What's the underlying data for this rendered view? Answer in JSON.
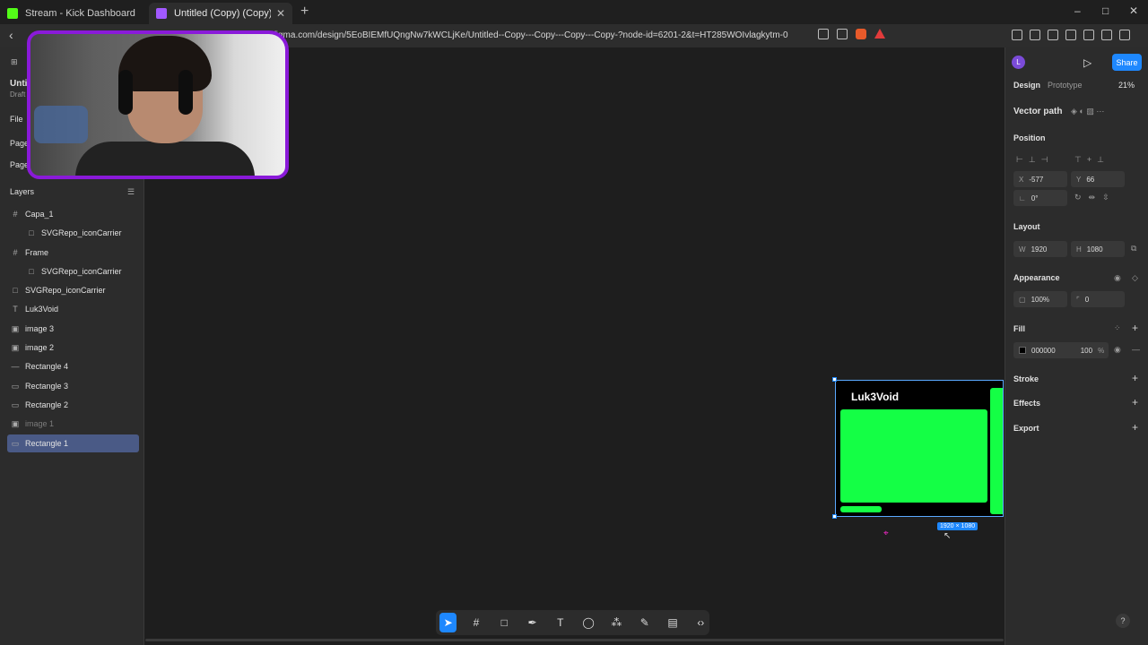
{
  "browser": {
    "tabs": [
      {
        "title": "Stream - Kick Dashboard",
        "favicon_color": "#53fc18"
      },
      {
        "title": "Untitled (Copy) (Copy) (C",
        "favicon_color": "#a259ff"
      }
    ],
    "new_tab": "+",
    "url": "figma.com/design/5EoBIEMfUQngNw7kWCLjKe/Untitled--Copy---Copy---Copy---Copy-?node-id=6201-2&t=HT285WOIvlagkytm-0",
    "window_controls": [
      "–",
      "□",
      "✕"
    ]
  },
  "left_panel": {
    "file_name": "Untit",
    "file_sub": "Draft",
    "file_menu": "File",
    "pages_label": "Page",
    "page_item": "Page 1",
    "layers_title": "Layers",
    "layers": [
      {
        "name": "Capa_1",
        "icon": "#",
        "indent": 0
      },
      {
        "name": "SVGRepo_iconCarrier",
        "icon": "□",
        "indent": 1
      },
      {
        "name": "Frame",
        "icon": "#",
        "indent": 0
      },
      {
        "name": "SVGRepo_iconCarrier",
        "icon": "□",
        "indent": 1
      },
      {
        "name": "SVGRepo_iconCarrier",
        "icon": "□",
        "indent": 0
      },
      {
        "name": "Luk3Void",
        "icon": "T",
        "indent": 0
      },
      {
        "name": "image 3",
        "icon": "▣",
        "indent": 0
      },
      {
        "name": "image 2",
        "icon": "▣",
        "indent": 0
      },
      {
        "name": "Rectangle 4",
        "icon": "—",
        "indent": 0
      },
      {
        "name": "Rectangle 3",
        "icon": "▭",
        "indent": 0
      },
      {
        "name": "Rectangle 2",
        "icon": "▭",
        "indent": 0
      },
      {
        "name": "image 1",
        "icon": "▣",
        "indent": 0
      },
      {
        "name": "Rectangle 1",
        "icon": "▭",
        "indent": 0
      }
    ]
  },
  "canvas": {
    "frame_title": "Luk3Void",
    "dimension_label": "1920 × 1080",
    "frame_color": "#000000",
    "accent_green": "#14ff45"
  },
  "toolbar": {
    "tools": [
      "move",
      "frame",
      "rectangle",
      "pen",
      "text",
      "comment",
      "actions",
      "draw",
      "dev-mode",
      "code"
    ]
  },
  "right_panel": {
    "avatar_letter": "L",
    "share_label": "Share",
    "tabs": [
      "Design",
      "Prototype"
    ],
    "zoom": "21%",
    "selection_type": "Vector path",
    "position_title": "Position",
    "x_label": "X",
    "x_value": "-577",
    "y_label": "Y",
    "y_value": "66",
    "rotation_value": "0°",
    "layout_title": "Layout",
    "w_label": "W",
    "w_value": "1920",
    "h_label": "H",
    "h_value": "1080",
    "appearance_title": "Appearance",
    "opacity_value": "100%",
    "radius_value": "0",
    "fill_title": "Fill",
    "fill_hex": "000000",
    "fill_opacity": "100",
    "fill_pct": "%",
    "stroke_title": "Stroke",
    "effects_title": "Effects",
    "export_title": "Export",
    "help": "?"
  }
}
